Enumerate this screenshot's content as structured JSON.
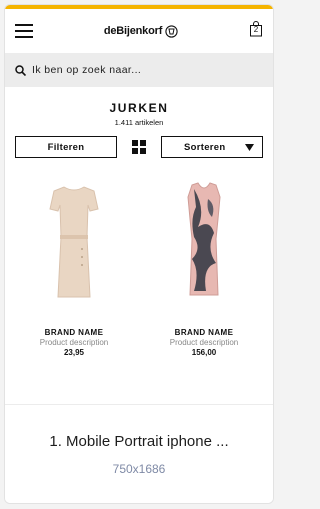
{
  "colors": {
    "accent": "#f5b400",
    "search_bg": "#ececec",
    "muted": "#888888",
    "caption_link": "#7f8aa6"
  },
  "header": {
    "menu_icon": "hamburger-icon",
    "logo_text": "deBijenkorf",
    "logo_icon": "bee-logo-icon",
    "bag_icon": "shopping-bag-icon",
    "bag_count": "2"
  },
  "search": {
    "icon": "search-icon",
    "placeholder": "Ik ben op zoek naar..."
  },
  "category": {
    "title": "JURKEN",
    "count": "1.411 artikelen"
  },
  "controls": {
    "filter_label": "Filteren",
    "grid_icon": "grid-view-icon",
    "sort_label": "Sorteren",
    "sort_icon": "caret-down-icon"
  },
  "products": [
    {
      "brand": "BRAND NAME",
      "description": "Product description",
      "price": "23,95"
    },
    {
      "brand": "BRAND NAME",
      "description": "Product description",
      "price": "156,00"
    }
  ],
  "caption": {
    "title": "1. Mobile Portrait iphone ...",
    "size": "750x1686"
  }
}
